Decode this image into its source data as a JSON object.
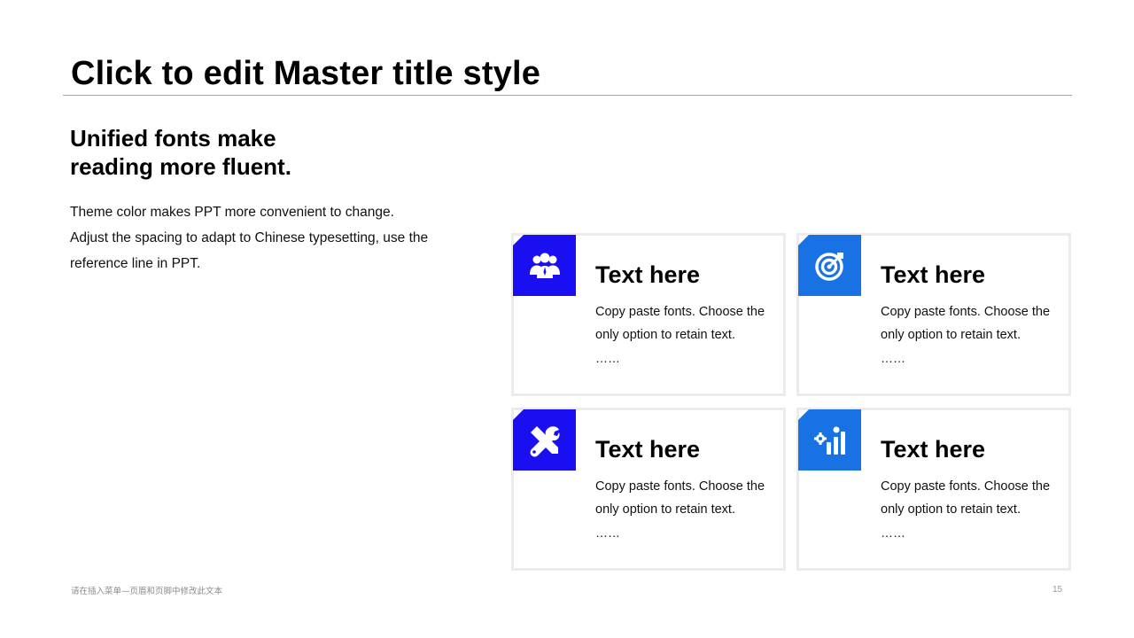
{
  "slide": {
    "title": "Click to edit Master title style",
    "subheading": "Unified fonts make reading more fluent.",
    "body": "Theme color makes PPT more convenient to change. Adjust the spacing to adapt to Chinese typesetting, use the reference line in PPT."
  },
  "colors": {
    "dark_blue": "#1a0ff0",
    "mid_blue": "#1872e3",
    "card_border": "#ebebeb",
    "rule": "#a6a6a6"
  },
  "cards": [
    {
      "icon": "team-icon",
      "heading": "Text here",
      "text": "Copy paste fonts. Choose the only option to retain text.",
      "ellipsis": "……"
    },
    {
      "icon": "target-icon",
      "heading": "Text here",
      "text": "Copy paste fonts. Choose the only option to retain text.",
      "ellipsis": "……"
    },
    {
      "icon": "tools-icon",
      "heading": "Text here",
      "text": "Copy paste fonts. Choose the only option to retain text.",
      "ellipsis": "……"
    },
    {
      "icon": "growth-chart-icon",
      "heading": "Text here",
      "text": "Copy paste fonts. Choose the only option to retain text.",
      "ellipsis": "……"
    }
  ],
  "footer": {
    "note": "请在插入菜单—页眉和页脚中修改此文本",
    "page_number": "15"
  }
}
